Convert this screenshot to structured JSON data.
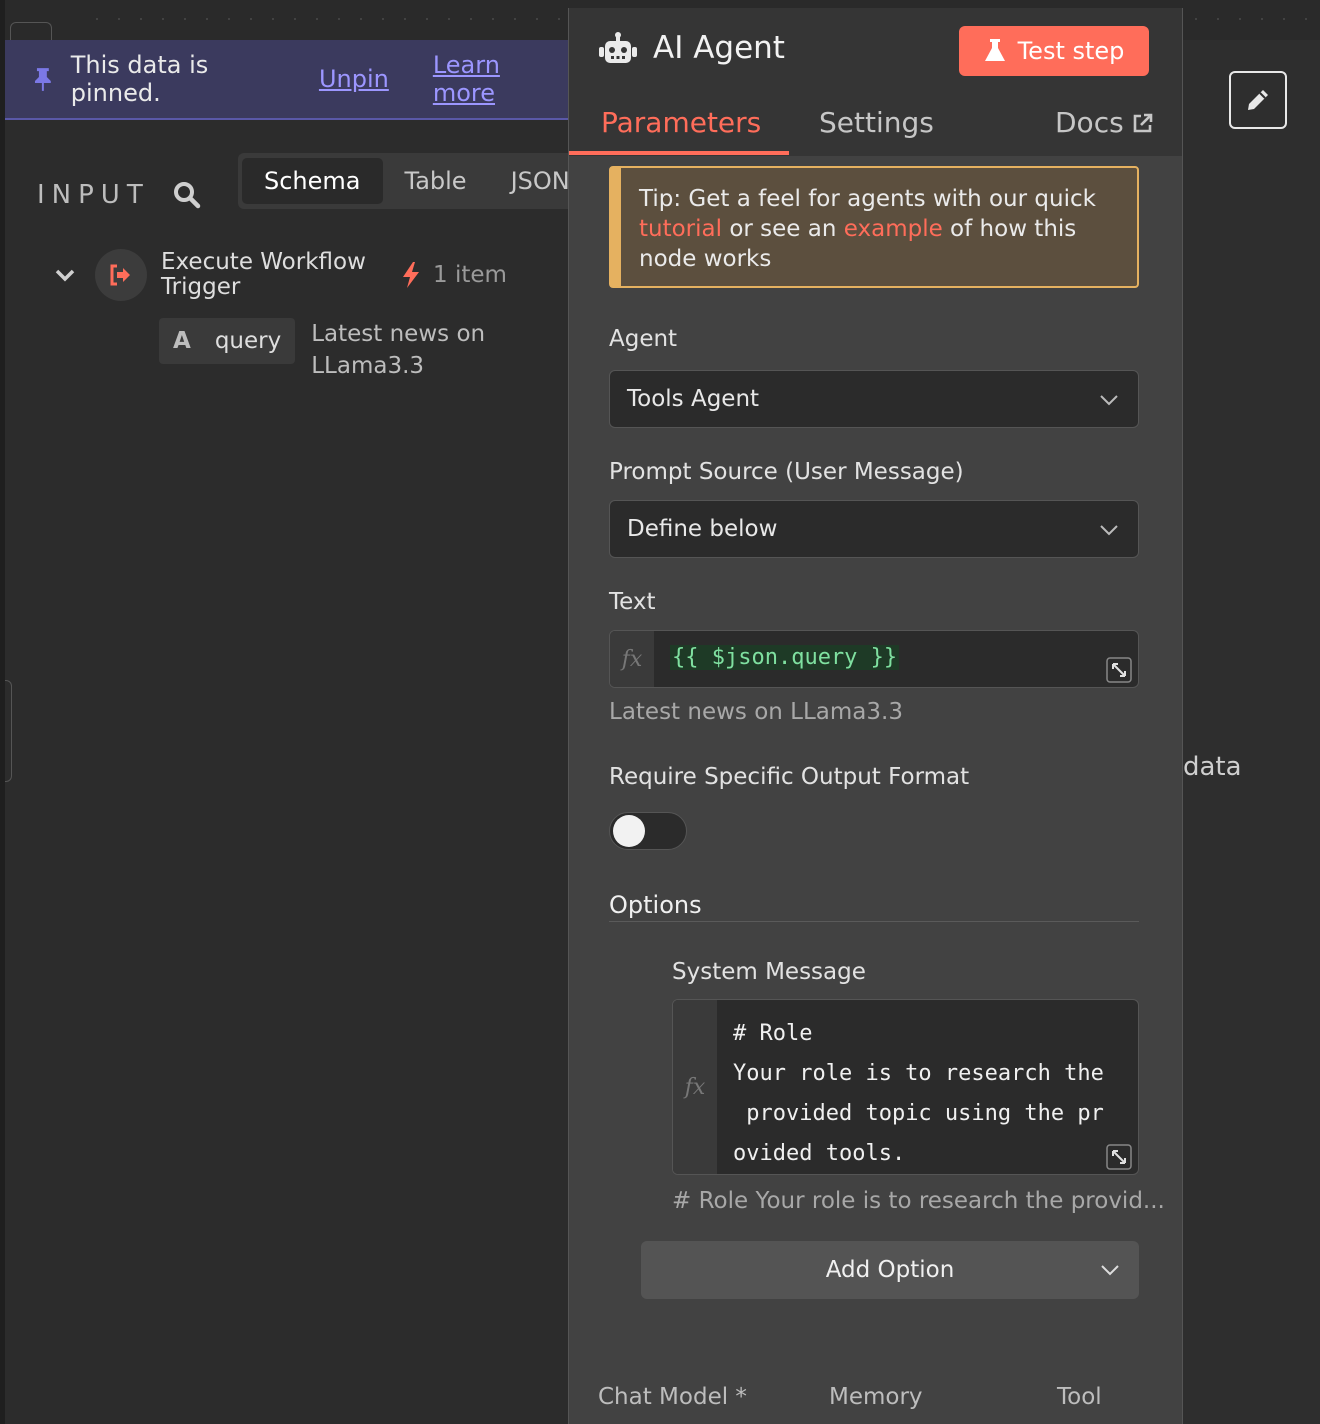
{
  "pinned": {
    "message": "This data is pinned.",
    "unpin": "Unpin",
    "learn_more": "Learn more"
  },
  "input": {
    "title": "INPUT",
    "view_tabs": [
      "Schema",
      "Table",
      "JSON"
    ],
    "node": {
      "name": "Execute Workflow Trigger",
      "item_count": "1 item"
    },
    "field": {
      "type": "A",
      "name": "query",
      "value": "Latest news on LLama3.3"
    }
  },
  "node_panel": {
    "title": "AI Agent",
    "test_button": "Test step",
    "tabs": {
      "parameters": "Parameters",
      "settings": "Settings",
      "docs": "Docs"
    },
    "tip": {
      "before": "Tip: Get a feel for agents with our quick ",
      "link1": "tutorial",
      "middle": " or see an ",
      "link2": "example",
      "after": " of how this node works"
    },
    "agent": {
      "label": "Agent",
      "value": "Tools Agent"
    },
    "prompt_source": {
      "label": "Prompt Source (User Message)",
      "value": "Define below"
    },
    "text": {
      "label": "Text",
      "fx": "fx",
      "expression": "{{ $json.query }}",
      "preview": "Latest news on LLama3.3"
    },
    "output_format": {
      "label": "Require Specific Output Format",
      "enabled": false
    },
    "options": {
      "title": "Options",
      "system_message": {
        "label": "System Message",
        "value": "# Role\nYour role is to research the\n provided topic using the pr\novided tools.",
        "preview": "# Role Your role is to research the provid..."
      },
      "add_option": "Add Option"
    },
    "connections": [
      "Chat Model *",
      "Memory",
      "Tool"
    ]
  },
  "output": {
    "fragment": "data"
  },
  "colors": {
    "accent": "#ff6d5a",
    "pinned_link": "#9c96ff",
    "tip_border": "#e5b160",
    "expr_green": "#7fe0a0"
  }
}
